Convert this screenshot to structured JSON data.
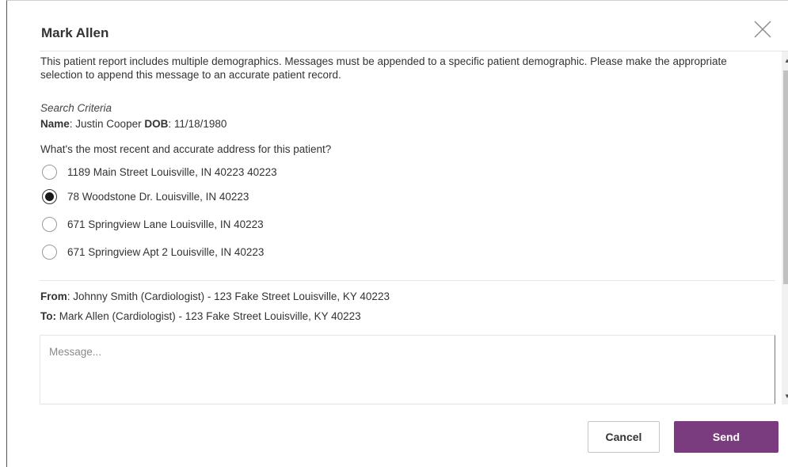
{
  "modal": {
    "title": "Mark Allen"
  },
  "intro_text": "This patient report includes multiple demographics. Messages must be appended to a specific patient demographic. Please make the appropriate selection to append this message to an accurate patient record.",
  "search_criteria": {
    "label": "Search Criteria",
    "name_label": "Name",
    "name_value": ": Justin Cooper ",
    "dob_label": "DOB",
    "dob_value": ": 11/18/1980"
  },
  "address_question": "What's the most recent and accurate address for this patient?",
  "addresses": [
    {
      "label": "1189 Main Street Louisville, IN 40223 40223",
      "selected": false
    },
    {
      "label": "78 Woodstone Dr. Louisville, IN 40223",
      "selected": true
    },
    {
      "label": "671 Springview Lane Louisville, IN 40223",
      "selected": false
    },
    {
      "label": "671 Springview Apt 2 Louisville, IN 40223",
      "selected": false
    }
  ],
  "from": {
    "label": "From",
    "value": ": Johnny Smith (Cardiologist) - 123 Fake Street Louisville, KY 40223"
  },
  "to": {
    "label": "To:",
    "value": " Mark Allen (Cardiologist) - 123 Fake Street Louisville, KY 40223"
  },
  "message": {
    "placeholder": "Message...",
    "value": ""
  },
  "buttons": {
    "cancel": "Cancel",
    "send": "Send"
  },
  "icons": {
    "close": "close-icon",
    "scroll_up": "scroll-up-arrow-icon",
    "scroll_down": "scroll-down-arrow-icon"
  },
  "colors": {
    "accent": "#7b3b7f",
    "text": "#333333"
  }
}
